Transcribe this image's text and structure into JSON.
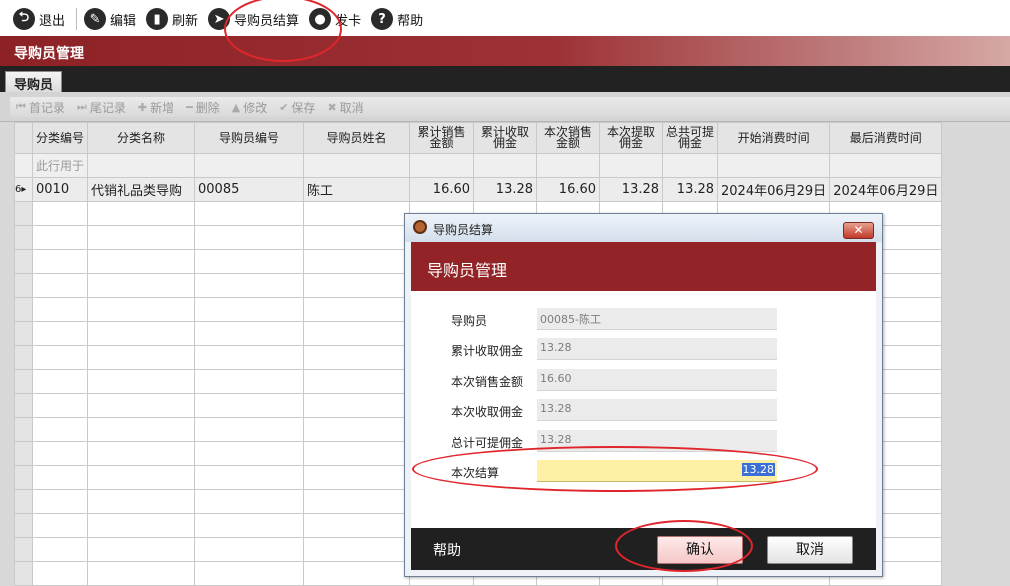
{
  "toolbar": {
    "items": [
      {
        "label": "退出",
        "icon": "exit-icon",
        "glyph": "⮌"
      },
      {
        "label": "编辑",
        "icon": "edit-icon",
        "glyph": "✎"
      },
      {
        "label": "刷新",
        "icon": "refresh-icon",
        "glyph": "▮"
      },
      {
        "label": "导购员结算",
        "icon": "send-icon",
        "glyph": "➤"
      },
      {
        "label": "发卡",
        "icon": "location-pin-icon",
        "glyph": "●"
      },
      {
        "label": "帮助",
        "icon": "help-icon",
        "glyph": "?"
      }
    ]
  },
  "module": {
    "title": "导购员管理",
    "tab": "导购员"
  },
  "subtoolbar": {
    "items": [
      "首记录",
      "尾记录",
      "新增",
      "删除",
      "修改",
      "保存",
      "取消"
    ]
  },
  "grid": {
    "columns": [
      "分类编号",
      "分类名称",
      "导购员编号",
      "导购员姓名",
      "累计销售金额",
      "累计收取佣金",
      "本次销售金额",
      "本次提取佣金",
      "总共可提佣金",
      "开始消费时间",
      "最后消费时间"
    ],
    "filter_hint": "此行用于",
    "row_marker": "6▸",
    "rows": [
      [
        "0010",
        "代销礼品类导购",
        "00085",
        "陈工",
        "16.60",
        "13.28",
        "16.60",
        "13.28",
        "13.28",
        "2024年06月29日",
        "2024年06月29日"
      ]
    ]
  },
  "dialog": {
    "window_title": "导购员结算",
    "close_label": "✕",
    "header": "导购员管理",
    "fields": [
      {
        "label": "导购员",
        "value": "00085-陈工"
      },
      {
        "label": "累计收取佣金",
        "value": "13.28"
      },
      {
        "label": "本次销售金额",
        "value": "16.60"
      },
      {
        "label": "本次收取佣金",
        "value": "13.28"
      },
      {
        "label": "总计可提佣金",
        "value": "13.28"
      }
    ],
    "settle": {
      "label": "本次结算",
      "value": "13.28"
    },
    "help_label": "帮助",
    "confirm_label": "确认",
    "cancel_label": "取消"
  },
  "colors": {
    "brand_red": "#922427",
    "annotation_red": "#e0262c",
    "edit_field_yellow": "#fdf0a4"
  }
}
